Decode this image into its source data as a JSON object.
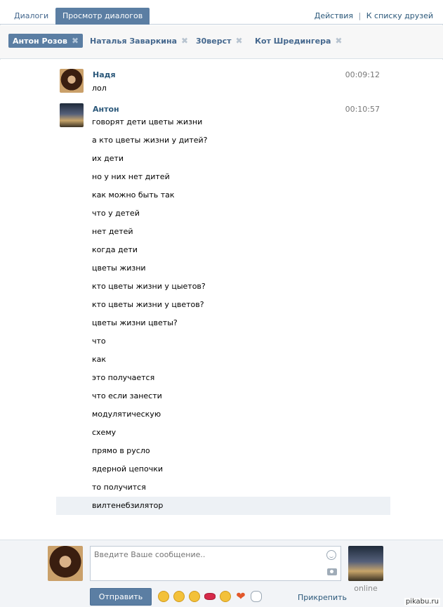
{
  "tabs": {
    "dialogs": "Диалоги",
    "view_dialogs": "Просмотр диалогов"
  },
  "top_links": {
    "actions": "Действия",
    "separator": "|",
    "friends_list": "К списку друзей"
  },
  "chips": [
    {
      "name": "Антон Розов",
      "active": true
    },
    {
      "name": "Наталья Заваркина",
      "active": false
    },
    {
      "name": "30верст",
      "active": false
    },
    {
      "name": "Кот Шредингера",
      "active": false
    }
  ],
  "chip_close": "✖",
  "messages": [
    {
      "author": "Надя",
      "time": "00:09:12",
      "lines": [
        "лол"
      ]
    },
    {
      "author": "Антон",
      "time": "00:10:57",
      "lines": [
        "говорят дети цветы жизни",
        "а кто цветы жизни у дитей?",
        "их дети",
        "но у них нет дитей",
        "как можно быть так",
        "что у детей",
        "нет детей",
        "когда дети",
        "цветы жизни",
        "кто цветы жизни у цыетов?",
        "кто цветы жизни у цветов?",
        "цветы жизни цветы?",
        "что",
        "как",
        "это получается",
        "что если занести",
        "модулятическую",
        "схему",
        "прямо в русло",
        "ядерной цепочки",
        "то получится",
        "вилтенебзилятор"
      ]
    }
  ],
  "compose": {
    "placeholder": "Введите Ваше сообщение..",
    "send_label": "Отправить",
    "attach_label": "Прикрепить",
    "online_label": "online"
  },
  "watermark": "pikabu.ru",
  "colors": {
    "accent": "#5b7ea3",
    "link": "#2b587a",
    "highlight_row": "#edf1f5"
  }
}
